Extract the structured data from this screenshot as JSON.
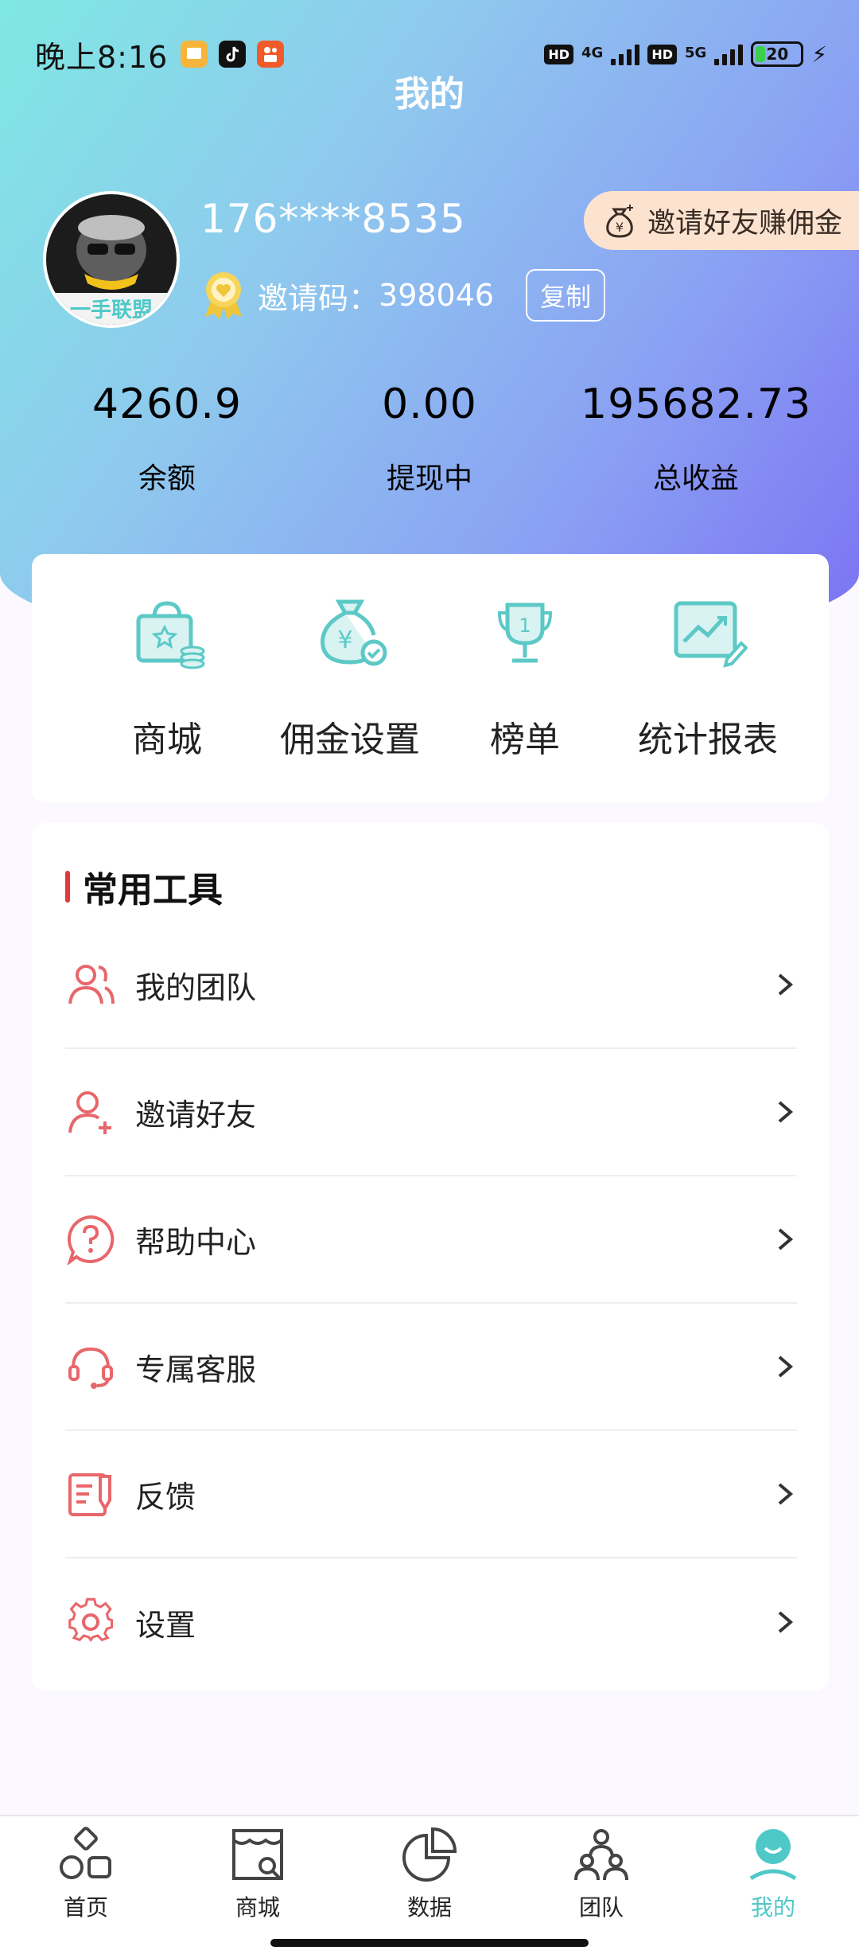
{
  "status_bar": {
    "time": "晚上8:16",
    "hd_1": "HD",
    "net_1": "4G",
    "hd_2": "HD",
    "net_2": "5G",
    "battery": "20"
  },
  "header": {
    "title": "我的"
  },
  "profile": {
    "avatar_text": "一手联盟",
    "phone": "176****8535",
    "invite_code_label": "邀请码：",
    "invite_code": "398046",
    "copy_label": "复制",
    "invite_friend_label": "邀请好友赚佣金"
  },
  "stats": [
    {
      "value": "4260.9",
      "label": "余额"
    },
    {
      "value": "0.00",
      "label": "提现中"
    },
    {
      "value": "195682.73",
      "label": "总收益"
    }
  ],
  "quick_actions": [
    {
      "label": "商城",
      "icon": "shopping-bag-icon"
    },
    {
      "label": "佣金设置",
      "icon": "money-bag-icon"
    },
    {
      "label": "榜单",
      "icon": "trophy-icon"
    },
    {
      "label": "统计报表",
      "icon": "chart-report-icon"
    }
  ],
  "tools": {
    "title": "常用工具",
    "items": [
      {
        "label": "我的团队",
        "icon": "team-icon"
      },
      {
        "label": "邀请好友",
        "icon": "add-user-icon"
      },
      {
        "label": "帮助中心",
        "icon": "help-icon"
      },
      {
        "label": "专属客服",
        "icon": "headset-icon"
      },
      {
        "label": "反馈",
        "icon": "feedback-icon"
      },
      {
        "label": "设置",
        "icon": "gear-icon"
      }
    ]
  },
  "tabbar": {
    "items": [
      {
        "label": "首页",
        "icon": "home-icon"
      },
      {
        "label": "商城",
        "icon": "store-icon"
      },
      {
        "label": "数据",
        "icon": "pie-chart-icon"
      },
      {
        "label": "团队",
        "icon": "team-tree-icon"
      },
      {
        "label": "我的",
        "icon": "profile-icon",
        "active": true
      }
    ]
  },
  "colors": {
    "accent_teal": "#4fc8c8",
    "tool_icon_red": "#e8676b",
    "title_mark_red": "#e2383f",
    "invite_button_bg": "#fbe3cf"
  }
}
